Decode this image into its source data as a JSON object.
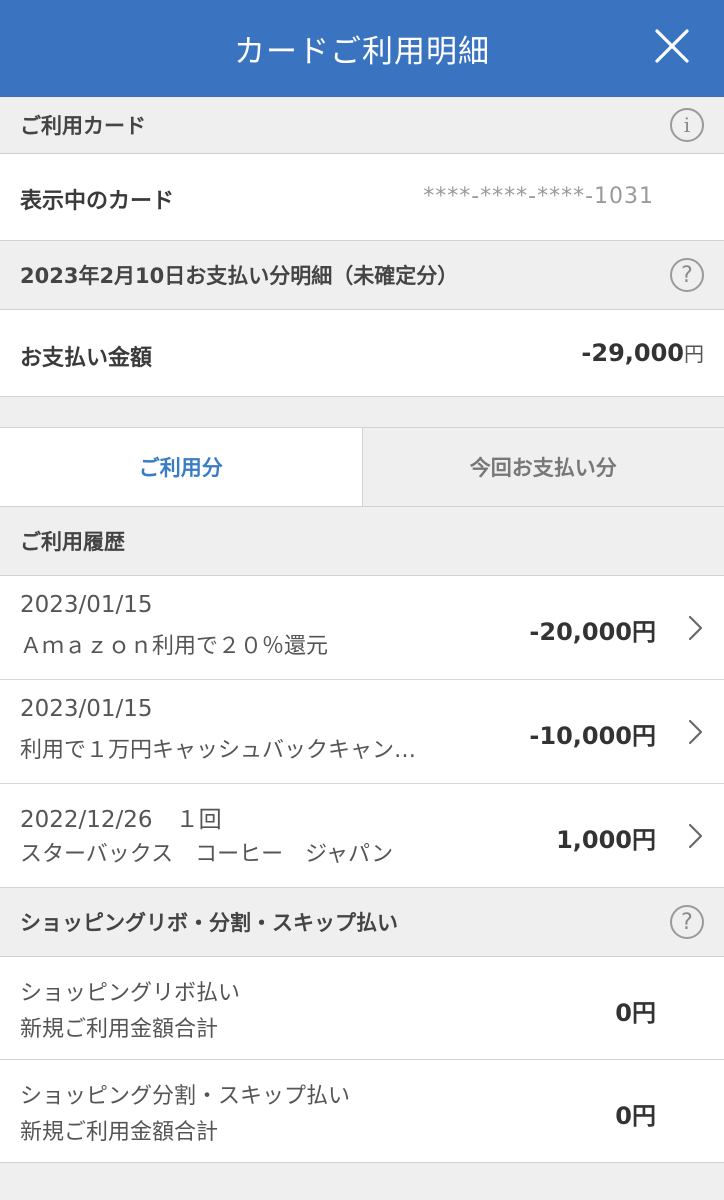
{
  "header": {
    "title": "カードご利用明細"
  },
  "card_section": {
    "heading": "ご利用カード",
    "label": "表示中のカード",
    "card_number": "****-****-****-1031"
  },
  "statement_section": {
    "heading": "2023年2月10日お支払い分明細（未確定分）",
    "label": "お支払い金額",
    "amount": "-29,000",
    "currency": "円"
  },
  "tabs": [
    {
      "label": "ご利用分",
      "active": true
    },
    {
      "label": "今回お支払い分",
      "active": false
    }
  ],
  "history": {
    "heading": "ご利用履歴",
    "items": [
      {
        "line1": "2023/01/15",
        "line2": "Ａｍａｚｏｎ利用で２０％還元",
        "amount": "-20,000円"
      },
      {
        "line1": "2023/01/15",
        "line2": "利用で１万円キャッシュバックキャン…",
        "amount": "-10,000円"
      },
      {
        "line1": "2022/12/26　１回",
        "line2": "スターバックス　コーヒー　ジャパン",
        "amount": "1,000円"
      }
    ]
  },
  "revolving": {
    "heading": "ショッピングリボ・分割・スキップ払い",
    "items": [
      {
        "line1": "ショッピングリボ払い",
        "line2": "新規ご利用金額合計",
        "amount": "0円"
      },
      {
        "line1": "ショッピング分割・スキップ払い",
        "line2": "新規ご利用金額合計",
        "amount": "0円"
      }
    ]
  },
  "colors": {
    "header_bg": "#3a74c1",
    "active_tab_text": "#3a7cc4",
    "page_bg": "#efefef"
  }
}
